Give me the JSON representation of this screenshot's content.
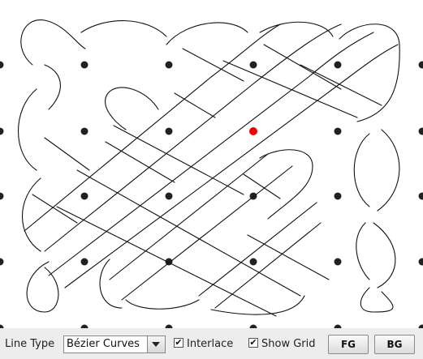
{
  "toolbar": {
    "line_type_label": "Line Type",
    "line_type_value": "Bézier Curves",
    "interlace_label": "Interlace",
    "interlace_checked": "✔",
    "show_grid_label": "Show Grid",
    "show_grid_checked": "✔",
    "fg_label": "FG",
    "bg_label": "BG"
  },
  "canvas": {
    "dot_color": "#222222",
    "selected_dot_color": "#ee0000",
    "line_color": "#111111"
  }
}
